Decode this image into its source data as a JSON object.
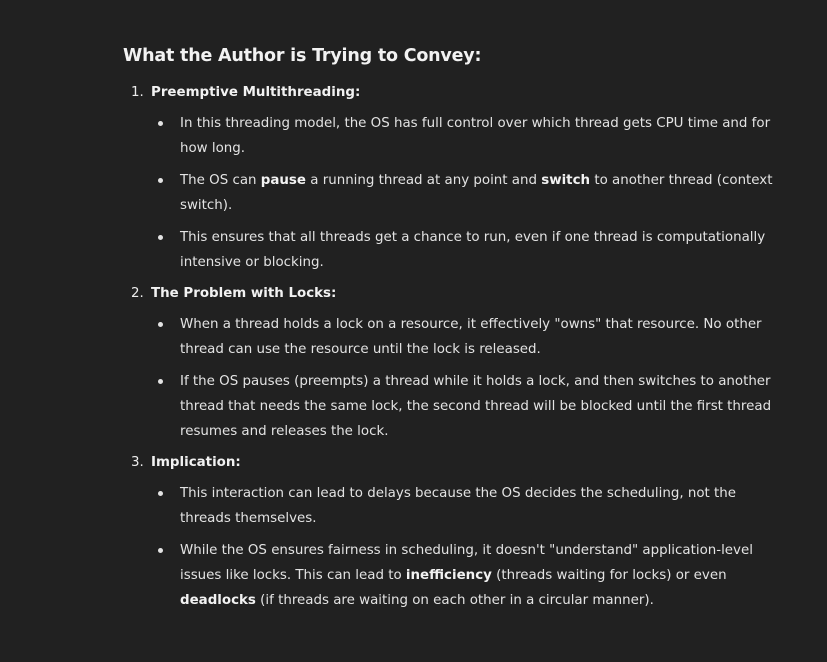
{
  "heading": "What the Author is Trying to Convey:",
  "sections": [
    {
      "num": "1.",
      "title": "Preemptive Multithreading:",
      "bullets": [
        {
          "parts": [
            {
              "t": "In this threading model, the OS has full control over which thread gets CPU time and for how long."
            }
          ]
        },
        {
          "parts": [
            {
              "t": "The OS can "
            },
            {
              "t": "pause",
              "b": true
            },
            {
              "t": " a running thread at any point and "
            },
            {
              "t": "switch",
              "b": true
            },
            {
              "t": " to another thread (context switch)."
            }
          ]
        },
        {
          "parts": [
            {
              "t": "This ensures that all threads get a chance to run, even if one thread is computationally intensive or blocking."
            }
          ]
        }
      ]
    },
    {
      "num": "2.",
      "title": "The Problem with Locks:",
      "bullets": [
        {
          "parts": [
            {
              "t": "When a thread holds a lock on a resource, it effectively \"owns\" that resource. No other thread can use the resource until the lock is released."
            }
          ]
        },
        {
          "parts": [
            {
              "t": "If the OS pauses (preempts) a thread while it holds a lock, and then switches to another thread that needs the same lock, the second thread will be blocked until the first thread resumes and releases the lock."
            }
          ]
        }
      ]
    },
    {
      "num": "3.",
      "title": "Implication:",
      "bullets": [
        {
          "parts": [
            {
              "t": "This interaction can lead to delays because the OS decides the scheduling, not the threads themselves."
            }
          ]
        },
        {
          "parts": [
            {
              "t": "While the OS ensures fairness in scheduling, it doesn't \"understand\" application-level issues like locks. This can lead to "
            },
            {
              "t": "inefficiency",
              "b": true
            },
            {
              "t": " (threads waiting for locks) or even "
            },
            {
              "t": "deadlocks",
              "b": true
            },
            {
              "t": " (if threads are waiting on each other in a circular manner)."
            }
          ]
        }
      ]
    }
  ]
}
